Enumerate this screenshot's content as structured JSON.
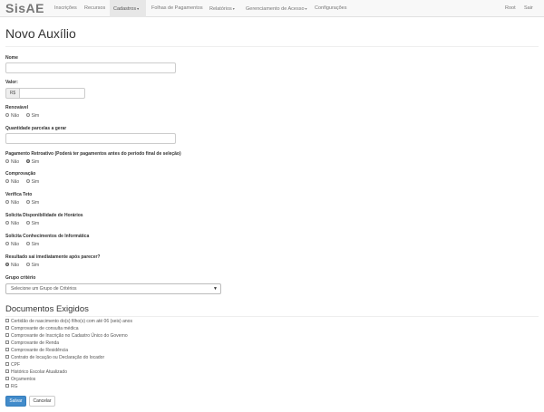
{
  "navbar": {
    "brand": "SisAE",
    "items": [
      {
        "label": "Inscrições"
      },
      {
        "label": "Recursos"
      },
      {
        "label": "Cadastros",
        "caret": "▾"
      },
      {
        "label": "Folhas de Pagamentos"
      },
      {
        "label": "Relatórios",
        "caret": "▾"
      },
      {
        "label": "Gerenciamento de Acesso",
        "caret": "▾"
      },
      {
        "label": "Configurações"
      }
    ],
    "user": "Root",
    "logout": "Sair"
  },
  "page": {
    "title": "Novo Auxílio"
  },
  "form": {
    "nome_label": "Nome",
    "valor_label": "Valor:",
    "valor_addon": "R$",
    "renovavel_label": "Renovável",
    "parcelas_label": "Quantidade parcelas a gerar",
    "retroativo_label": "Pagamento Retroativo (Poderá ter pagamentos antes do período final de seleção)",
    "comprovacao_label": "Comprovação",
    "teto_label": "Verifica Teto",
    "horarios_label": "Solicita Disponibilidade de Horários",
    "informatica_label": "Solicita Conhecimentos de Informática",
    "resultado_label": "Resultado sai imediatamente após parecer?",
    "grupo_label": "Grupo critério",
    "grupo_selected": "Selecione um Grupo de Critérios",
    "opt_nao": "Não",
    "opt_sim": "Sim"
  },
  "radios": {
    "renovavel": "none",
    "retroativo": "sim",
    "comprovacao": "none",
    "teto": "none",
    "horarios": "none",
    "informatica": "none",
    "resultado": "nao"
  },
  "documentos": {
    "title": "Documentos Exigidos",
    "items": [
      "Certidão de nascimento do(s) filho(s) com até 06 (seis) anos",
      "Comprovante de consulta médica",
      "Comprovante de Inscrição no Cadastro Único do Governo",
      "Comprovante de Renda",
      "Comprovante de Residência",
      "Contrato de locação ou Declaração do locador",
      "CPF",
      "Histórico Escolar Atualizado",
      "Orçamentos",
      "RG"
    ]
  },
  "buttons": {
    "save": "Salvar",
    "cancel": "Cancelar"
  }
}
